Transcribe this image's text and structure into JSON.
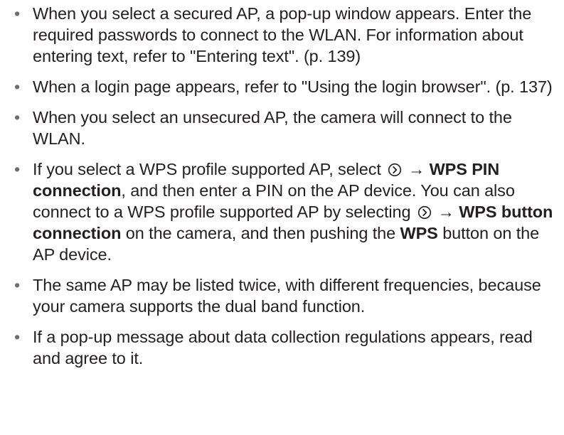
{
  "bullets": [
    {
      "text": "When you select a secured AP, a pop-up window appears. Enter the required passwords to connect to the WLAN. For information about entering text, refer to \"Entering text\". (p. 139)"
    },
    {
      "text": "When a login page appears, refer to \"Using the login browser\". (p. 137)"
    },
    {
      "text": "When you select an unsecured AP, the camera will connect to the WLAN."
    },
    {
      "part1": "If you select a WPS profile supported AP, select",
      "arrow1": "→",
      "bold1": "WPS PIN connection",
      "part2": ", and then enter a PIN on the AP device. You can also connect to a WPS profile supported AP by selecting",
      "arrow2": "→",
      "bold2": "WPS button connection",
      "part3": "on the camera, and then pushing the",
      "bold3": "WPS",
      "part4": "button on the AP device."
    },
    {
      "text": "The same AP may be listed twice, with different frequencies, because your camera supports the dual band function."
    },
    {
      "text": "If a pop-up message about data collection regulations appears, read and agree to it."
    }
  ],
  "bullet_glyph": "•",
  "icons": {
    "menu_icon": "circle-chevron-right-icon"
  }
}
